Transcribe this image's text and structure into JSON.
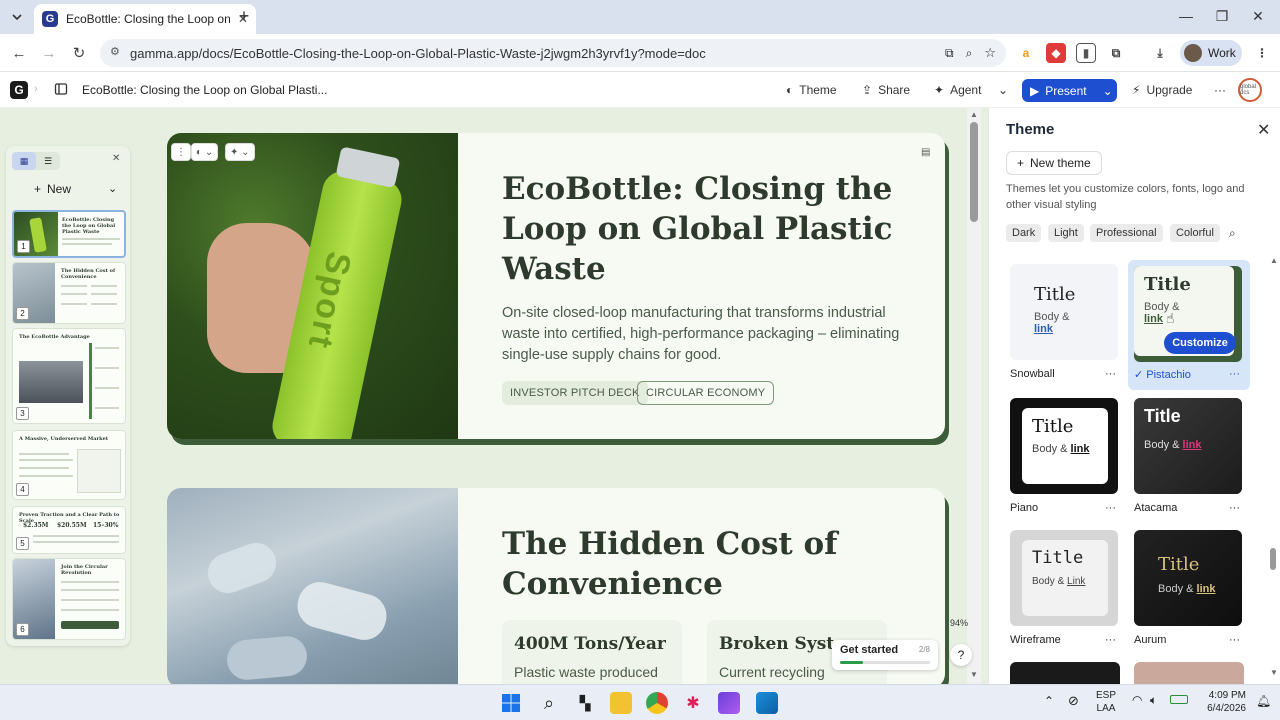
{
  "browser": {
    "tab_title": "EcoBottle: Closing the Loop on",
    "url": "gamma.app/docs/EcoBottle-Closing-the-Loop-on-Global-Plastic-Waste-j2jwgm2h3yrvf1y?mode=doc",
    "profile_name": "Work"
  },
  "app_header": {
    "logo": "G",
    "doc_title": "EcoBottle: Closing the Loop on Global Plasti...",
    "theme_label": "Theme",
    "share_label": "Share",
    "agent_label": "Agent",
    "present_label": "Present",
    "upgrade_label": "Upgrade",
    "account_initials": "global dcs"
  },
  "left_panel": {
    "new_label": "New",
    "slides": [
      {
        "num": "1",
        "title": "EcoBottle: Closing the Loop on Global Plastic Waste"
      },
      {
        "num": "2",
        "title": "The Hidden Cost of Convenience"
      },
      {
        "num": "3",
        "title": "The EcoBottle Advantage"
      },
      {
        "num": "4",
        "title": "A Massive, Underserved Market"
      },
      {
        "num": "5",
        "title": "Proven Traction and a Clear Path to Scale",
        "stats": [
          "$2.35M",
          "$20.55M",
          "15–30%"
        ]
      },
      {
        "num": "6",
        "title": "Join the Circular Revolution"
      }
    ]
  },
  "slide1": {
    "title": "EcoBottle: Closing the Loop on Global Plastic Waste",
    "description": "On-site closed-loop manufacturing that transforms industrial waste into certified, high-performance packaging – eliminating single-use supply chains for good.",
    "chips": [
      "INVESTOR PITCH DECK",
      "CIRCULAR ECONOMY"
    ],
    "bottle_text": "Sport"
  },
  "slide2": {
    "title": "The Hidden Cost of Convenience",
    "cards": [
      {
        "title": "400M Tons/Year",
        "sub": "Plastic waste produced"
      },
      {
        "title": "Broken System",
        "sub": "Current recycling"
      }
    ]
  },
  "overlay": {
    "get_started": "Get started",
    "progress": "2/8",
    "progress_fraction": 0.25,
    "zoom": "94%",
    "help": "?"
  },
  "theme_panel": {
    "title": "Theme",
    "new_theme": "New theme",
    "description": "Themes let you customize colors, fonts, logo and other visual styling",
    "filters": [
      "Dark",
      "Light",
      "Professional",
      "Colorful"
    ],
    "customize": "Customize",
    "themes": [
      {
        "name": "Snowball",
        "title": "Title",
        "body": "Body &",
        "link": "link",
        "selected": false
      },
      {
        "name": "Pistachio",
        "title": "Title",
        "body": "Body &",
        "link": "link",
        "selected": true
      },
      {
        "name": "Piano",
        "title": "Title",
        "body": "Body &",
        "link": "link",
        "selected": false
      },
      {
        "name": "Atacama",
        "title": "Title",
        "body": "Body &",
        "link": "link",
        "selected": false
      },
      {
        "name": "Wireframe",
        "title": "Title",
        "body": "Body &",
        "link": "Link",
        "selected": false
      },
      {
        "name": "Aurum",
        "title": "Title",
        "body": "Body &",
        "link": "link",
        "selected": false
      }
    ]
  },
  "taskbar": {
    "lang_top": "ESP",
    "lang_bottom": "LAA",
    "time": "4:09 PM",
    "date": "6/4/2026"
  },
  "colors": {
    "accent": "#1f4fd1",
    "slide_bg": "#f6faf3",
    "canvas_bg": "#e6efe0",
    "slide_shadow": "#3d5c3a",
    "heading": "#2e3a2c"
  }
}
